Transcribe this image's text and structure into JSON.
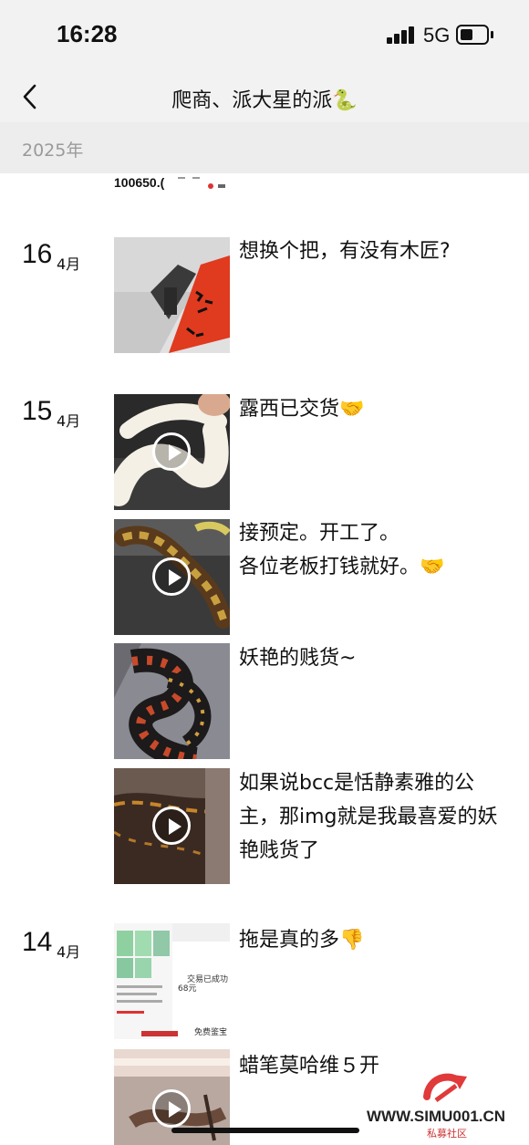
{
  "status_bar": {
    "time": "16:28",
    "network": "5G"
  },
  "nav": {
    "title": "爬商、派大星的派🐍"
  },
  "year": "2025年",
  "prev_strip_text": "100650.(",
  "groups": [
    {
      "day": "16",
      "month": "4月",
      "posts": [
        {
          "text": "想换个把，有没有木匠?",
          "media": "image"
        }
      ]
    },
    {
      "day": "15",
      "month": "4月",
      "posts": [
        {
          "text": "露西已交货🤝",
          "media": "video"
        },
        {
          "text": "接预定。开工了。\n各位老板打钱就好。🤝",
          "media": "video"
        },
        {
          "text": "妖艳的贱货~",
          "media": "image"
        },
        {
          "text": "如果说bcc是恬静素雅的公主，那img就是我最喜爱的妖艳贱货了",
          "media": "video"
        }
      ]
    },
    {
      "day": "14",
      "month": "4月",
      "posts": [
        {
          "text": "拖是真的多👎",
          "media": "image"
        },
        {
          "text": "蜡笔莫哈维５开",
          "media": "video"
        }
      ]
    }
  ],
  "thumb_overlay": {
    "price": "68元",
    "line1": "交易已成功",
    "line2": "免费鉴宝"
  },
  "watermark": {
    "text": "WWW.SIMU001.CN",
    "sub": "私募社区"
  },
  "colors": {
    "status_bg": "#f2f2f2",
    "year_bg": "#ededed",
    "year_text": "#9a9a9a"
  }
}
